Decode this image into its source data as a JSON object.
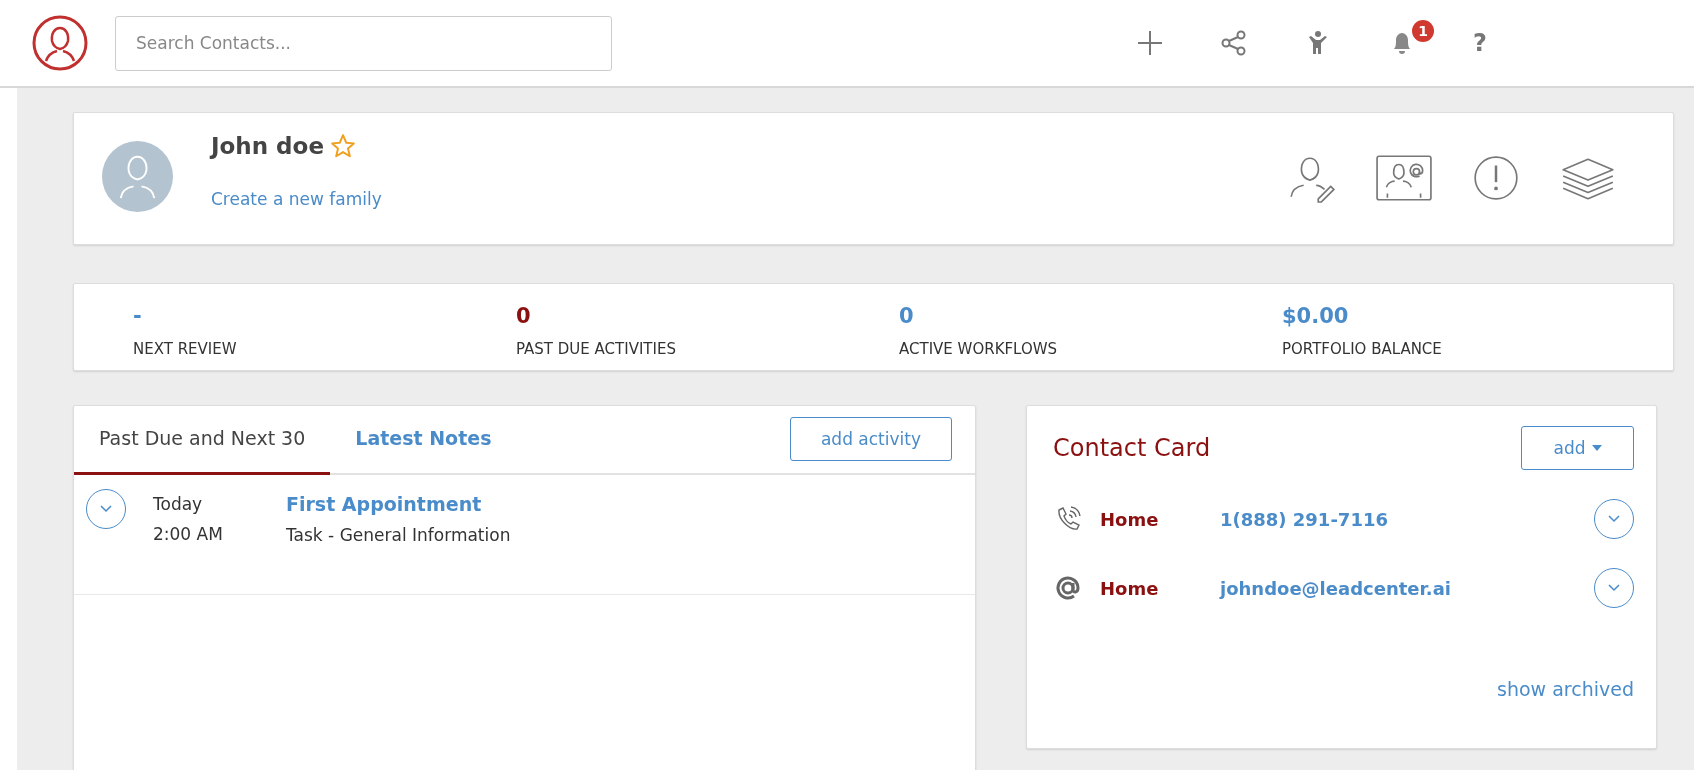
{
  "header": {
    "search": {
      "placeholder": "Search Contacts..."
    },
    "notification_count": "1",
    "help": "?"
  },
  "profile": {
    "name": "John doe",
    "starred": false,
    "family_link": "Create a new family"
  },
  "stats": [
    {
      "value": "-",
      "label": "NEXT REVIEW",
      "color": "#4a8bc9"
    },
    {
      "value": "0",
      "label": "PAST DUE ACTIVITIES",
      "color": "#8b1111"
    },
    {
      "value": "0",
      "label": "ACTIVE WORKFLOWS",
      "color": "#4a8bc9"
    },
    {
      "value": "$0.00",
      "label": "PORTFOLIO BALANCE",
      "color": "#4a8bc9"
    }
  ],
  "activities": {
    "tabs": [
      {
        "label": "Past Due and Next 30",
        "selected": true
      },
      {
        "label": "Latest Notes",
        "selected": false
      }
    ],
    "add_button": "add activity",
    "items": [
      {
        "day": "Today",
        "time": "2:00 AM",
        "title": "First Appointment",
        "subtitle": "Task - General Information"
      }
    ]
  },
  "contact_card": {
    "title": "Contact Card",
    "add_button": "add",
    "entries": [
      {
        "kind": "phone",
        "label": "Home",
        "value": "1(888) 291-7116"
      },
      {
        "kind": "email",
        "label": "Home",
        "value": "johndoe@leadcenter.ai"
      }
    ],
    "show_archived": "show archived"
  }
}
